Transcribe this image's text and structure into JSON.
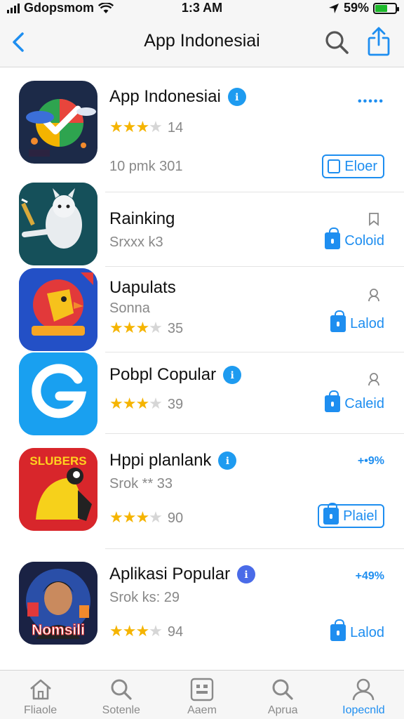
{
  "status_bar": {
    "carrier": "Gdopsmom",
    "time": "1:3 AM",
    "battery": "59%",
    "battery_level": 0.59
  },
  "nav": {
    "title": "App Indonesiai",
    "back_icon": "chevron-left-icon",
    "search_icon": "search-icon",
    "share_icon": "share-icon"
  },
  "apps": [
    {
      "name": "App Indonesiai",
      "verified_glyph": "ℹ",
      "rating": 3,
      "rating_count": "14",
      "meta": "10 pmk 301",
      "side": "•••••",
      "button": "Eloer",
      "button_icon": "square-icon"
    },
    {
      "name": "Rainking",
      "sub": "Srxxx k3",
      "button": "Coloid",
      "button_icon": "lock-icon",
      "side_icon": "bookmark-icon"
    },
    {
      "name": "Uapulats",
      "sub": "Sonna",
      "rating": 3,
      "rating_count": "35",
      "button": "Lalod",
      "button_icon": "lock-icon",
      "side_icon": "person-icon"
    },
    {
      "name": "Pobpl Copular",
      "verified_glyph": "ℹ",
      "rating": 3,
      "rating_count": "39",
      "button": "Caleid",
      "button_icon": "lock-icon",
      "side_icon": "person-icon"
    },
    {
      "name": "Hppi planlank",
      "verified_glyph": "ℹ",
      "sub": "Srok ** 33",
      "rating": 3,
      "rating_count": "90",
      "side": "+•9%",
      "button": "Plaiel",
      "button_icon": "lock-icon",
      "icon_text": "SLUBERS"
    },
    {
      "name": "Aplikasi Popular",
      "verified_glyph": "ℹ",
      "sub": "Srok ks: 29",
      "rating": 3,
      "rating_count": "94",
      "side": "+49%",
      "button": "Lalod",
      "button_icon": "lock-icon",
      "icon_text": "Nomsili"
    }
  ],
  "tabs": [
    {
      "label": "Fliaole",
      "icon": "home-icon"
    },
    {
      "label": "Sotenle",
      "icon": "search-icon"
    },
    {
      "label": "Aaem",
      "icon": "apps-icon"
    },
    {
      "label": "Aprua",
      "icon": "search-icon"
    },
    {
      "label": "Iopecnld",
      "icon": "person-icon"
    }
  ],
  "colors": {
    "accent": "#1e8ef0",
    "star": "#f5b400",
    "verified": "#1e9bf0",
    "battery": "#1db92b"
  }
}
